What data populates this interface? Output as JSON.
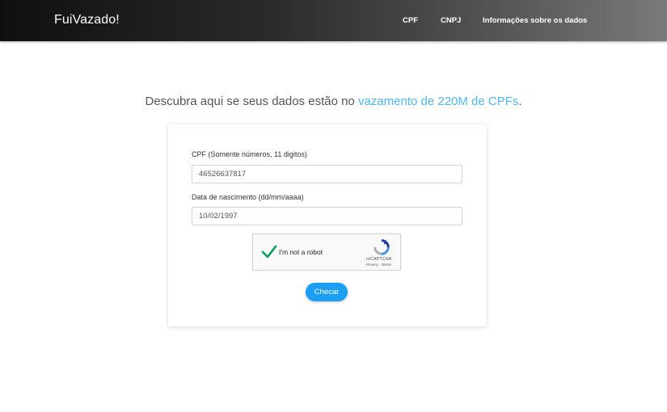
{
  "navbar": {
    "brand": "FuiVazado!",
    "links": [
      "CPF",
      "CNPJ",
      "Informações sobre os dados"
    ]
  },
  "headline": {
    "text_before": "Descubra aqui se seus dados estão no ",
    "link_text": "vazamento de 220M  de CPFs",
    "text_after": "."
  },
  "form": {
    "cpf_label": "CPF (Somente números, 11 digitos)",
    "cpf_value": "46526637817",
    "dob_label": "Data de nascimento (dd/mm/aaaa)",
    "dob_value": "10/02/1997",
    "captcha": {
      "label": "I'm not a robot",
      "brand": "reCAPTCHA",
      "links": "Privacy - Terms",
      "checked": true
    },
    "submit_label": "Checar"
  },
  "colors": {
    "accent": "#1a9ff5",
    "link": "#4fb7f2",
    "check": "#0a9d58"
  }
}
